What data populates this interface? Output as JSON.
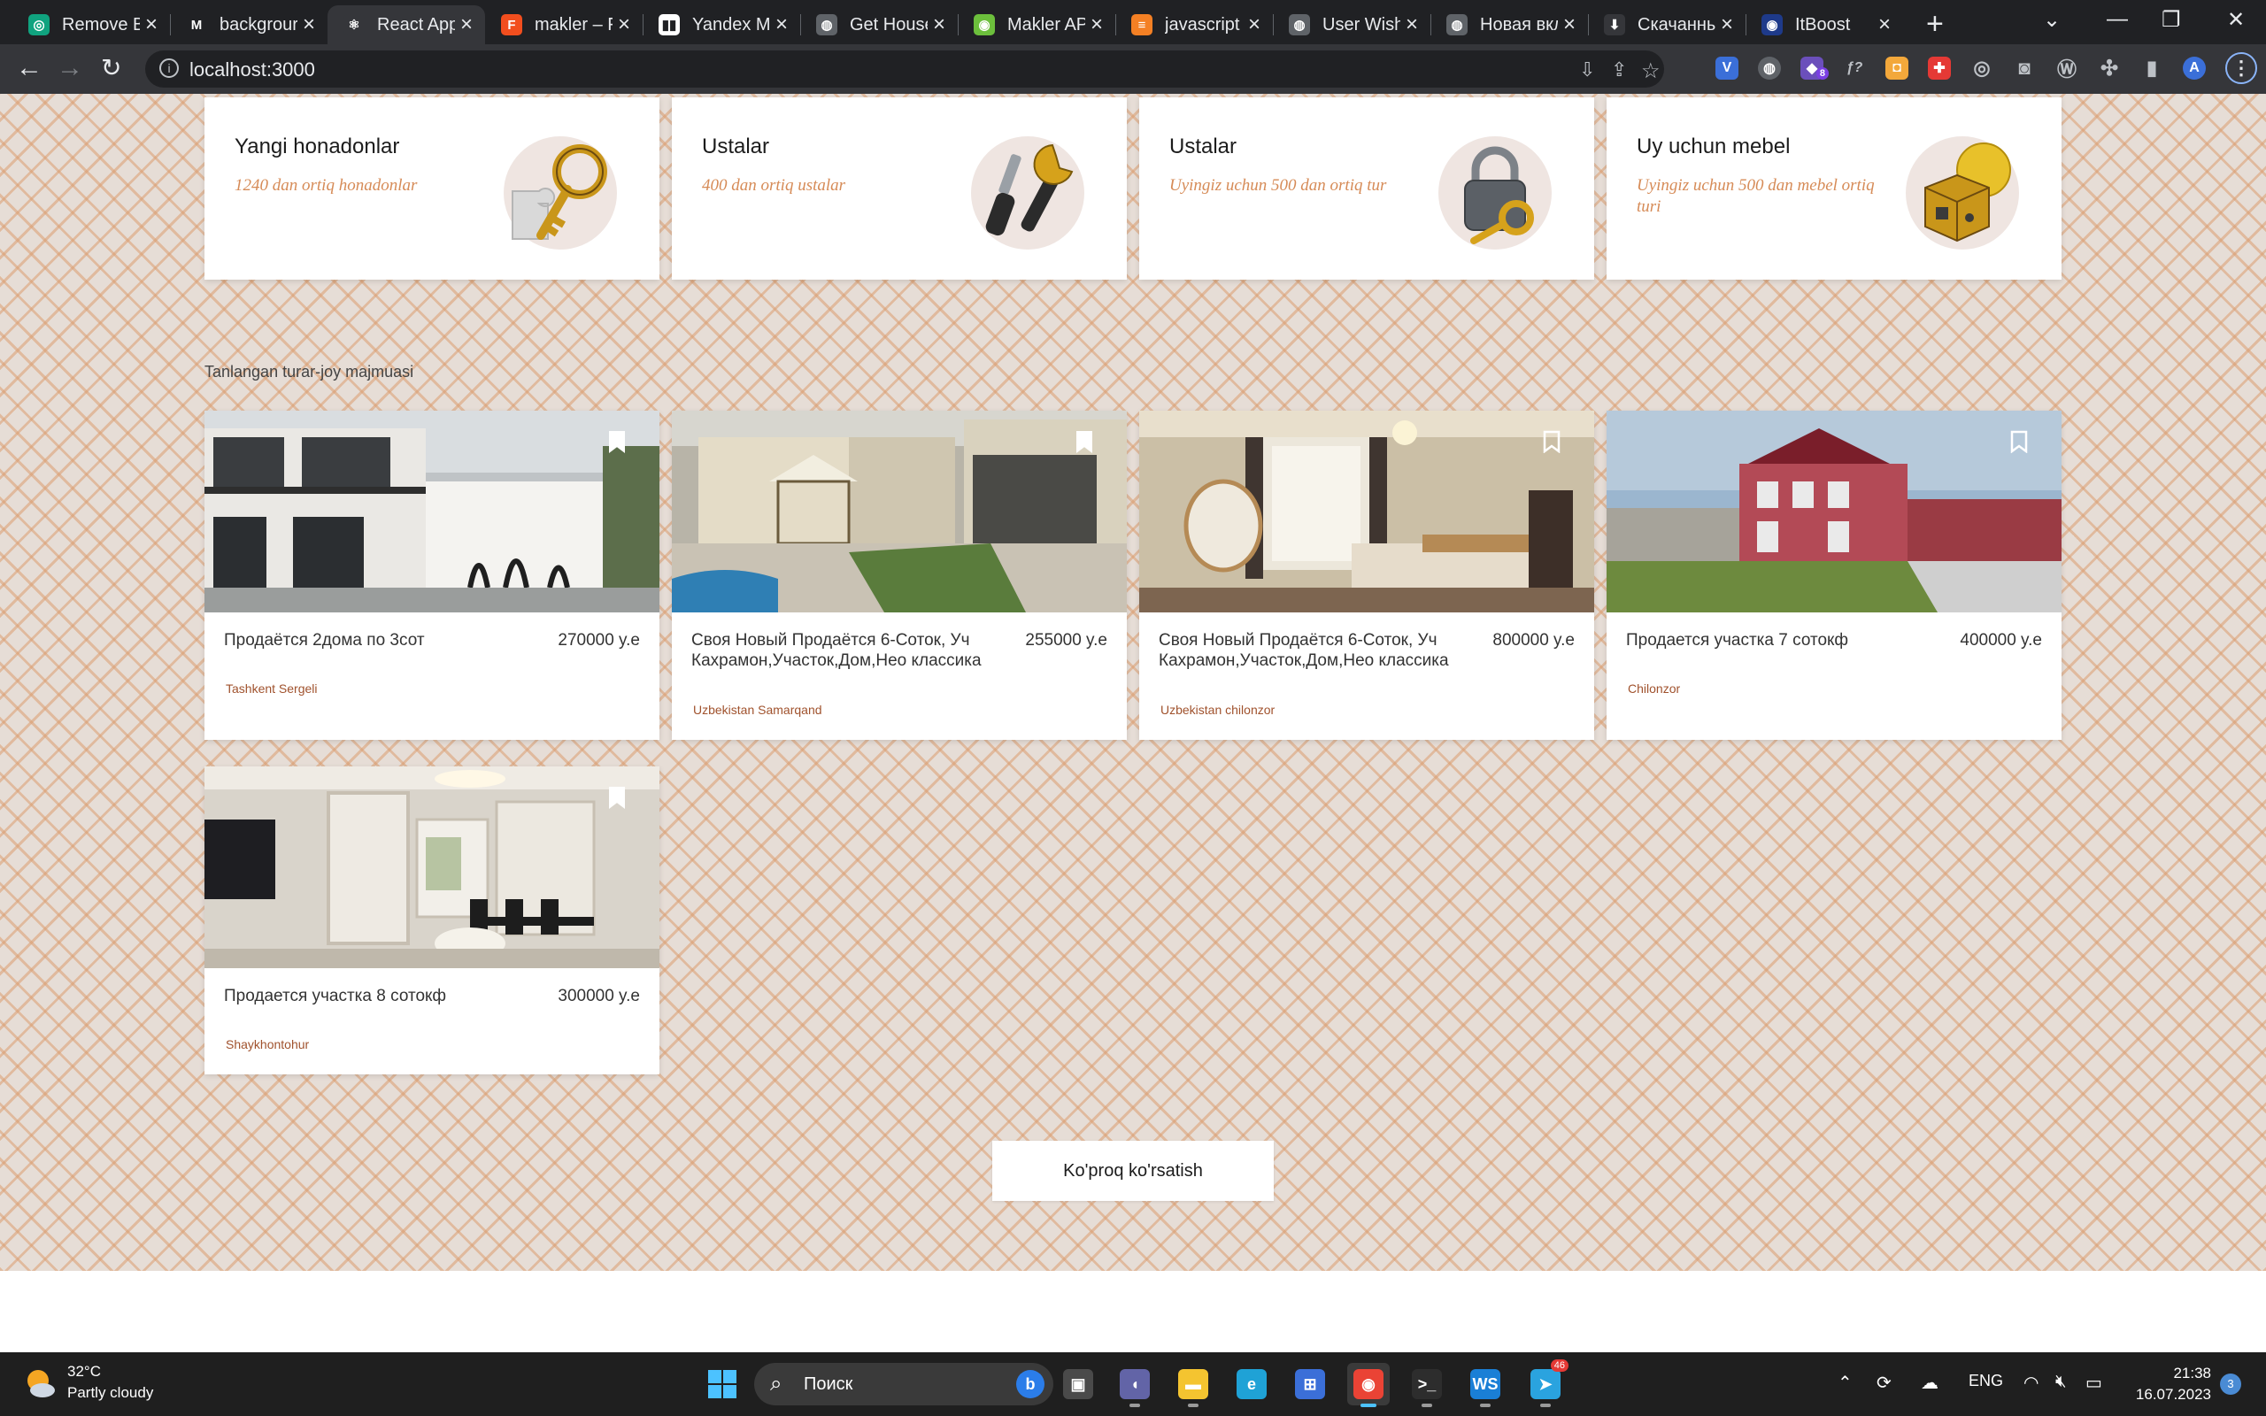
{
  "browser": {
    "tabs": [
      {
        "title": "Remove B",
        "fav_color": "#10a37f",
        "fav_glyph": "◎"
      },
      {
        "title": "backgrour",
        "fav_color": "#202124",
        "fav_glyph": "M"
      },
      {
        "title": "React App",
        "fav_color": "#35363a",
        "fav_glyph": "⚛"
      },
      {
        "title": "makler – F",
        "fav_color": "#f24e1e",
        "fav_glyph": "F"
      },
      {
        "title": "Yandex M",
        "fav_color": "#ffffff",
        "fav_glyph": "▮▮"
      },
      {
        "title": "Get House",
        "fav_color": "#5f6368",
        "fav_glyph": "◍"
      },
      {
        "title": "Makler AP",
        "fav_color": "#6cbf3c",
        "fav_glyph": "◉"
      },
      {
        "title": "javascript",
        "fav_color": "#f48024",
        "fav_glyph": "≡"
      },
      {
        "title": "User Wish",
        "fav_color": "#5f6368",
        "fav_glyph": "◍"
      },
      {
        "title": "Новая вкл",
        "fav_color": "#5f6368",
        "fav_glyph": "◍"
      },
      {
        "title": "Скачанны",
        "fav_color": "#35363a",
        "fav_glyph": "⬇"
      },
      {
        "title": "ItBoost",
        "fav_color": "#1e3a8a",
        "fav_glyph": "◉"
      }
    ],
    "active_tab": 2,
    "url": "localhost:3000"
  },
  "services": [
    {
      "title": "Yangi honadonlar",
      "subtitle": "1240 dan ortiq honadonlar",
      "icon": "key-puzzle"
    },
    {
      "title": "Ustalar",
      "subtitle": "400 dan ortiq ustalar",
      "icon": "tools"
    },
    {
      "title": "Ustalar",
      "subtitle": "Uyingiz uchun 500 dan ortiq tur",
      "icon": "padlock"
    },
    {
      "title": "Uy uchun mebel",
      "subtitle": "Uyingiz uchun 500 dan mebel ortiq turi",
      "icon": "furniture-cube"
    }
  ],
  "section_title": "Tanlangan turar-joy majmuasi",
  "properties": [
    {
      "title": "Продаётся 2дома по 3сот",
      "price": "270000 y.e",
      "location": "Tashkent Sergeli",
      "photo": "two-storey-house-facade",
      "bookmarked": false
    },
    {
      "title": "Своя Новый Продаётся 6-Соток, Уч Кахрамон,Участок,Дом,Нео классика",
      "price": "255000 y.e",
      "location": "Uzbekistan Samarqand",
      "photo": "courtyard-with-gazebo",
      "bookmarked": true
    },
    {
      "title": "Своя Новый Продаётся 6-Соток, Уч Кахрамон,Участок,Дом,Нео классика",
      "price": "800000 y.e",
      "location": "Uzbekistan chilonzor",
      "photo": "classic-bedroom",
      "bookmarked": false
    },
    {
      "title": "Продается участка 7 сотокф",
      "price": "400000 y.e",
      "location": "Chilonzor",
      "photo": "red-brick-house",
      "bookmarked": false
    },
    {
      "title": "Продается участка 8 сотокф",
      "price": "300000 y.e",
      "location": "Shaykhontohur",
      "photo": "dining-room-interior",
      "bookmarked": true
    }
  ],
  "more_button": "Ko'proq ko'rsatish",
  "taskbar": {
    "weather_temp": "32°C",
    "weather_desc": "Partly cloudy",
    "search_placeholder": "Поиск",
    "language": "ENG",
    "time": "21:38",
    "date": "16.07.2023",
    "notifications": "3",
    "telegram_badge": "46",
    "extension_badge": "8",
    "apps": [
      {
        "name": "windows-start",
        "color": "#3aa0f3",
        "glyph": "⊞"
      },
      {
        "name": "task-view",
        "color": "#4a4a4a",
        "glyph": "▣"
      },
      {
        "name": "teams-chat",
        "color": "#6264a7",
        "glyph": "◖"
      },
      {
        "name": "file-explorer",
        "color": "#f4c430",
        "glyph": "▬"
      },
      {
        "name": "edge-browser",
        "color": "#1fa2d6",
        "glyph": "e"
      },
      {
        "name": "microsoft-store",
        "color": "#3b6fd8",
        "glyph": "⊞"
      },
      {
        "name": "chrome-browser",
        "color": "#ea4335",
        "glyph": "◉"
      },
      {
        "name": "terminal",
        "color": "#2d2d2d",
        "glyph": ">_"
      },
      {
        "name": "webstorm",
        "color": "#1a7fd6",
        "glyph": "WS"
      },
      {
        "name": "telegram",
        "color": "#2aa3df",
        "glyph": "➤"
      }
    ]
  }
}
